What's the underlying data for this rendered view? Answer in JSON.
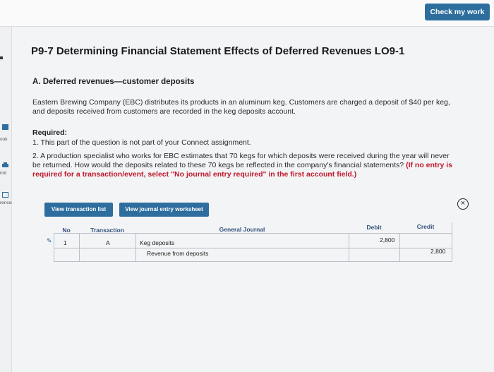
{
  "topbar": {
    "check_label": "Check my work"
  },
  "leftrail": {
    "item1": "ook",
    "item2": "rint",
    "item3": "rences"
  },
  "problem": {
    "title": "P9-7 Determining Financial Statement Effects of Deferred Revenues LO9-1",
    "section_title": "A. Deferred revenues—customer deposits",
    "intro_line1": "Eastern Brewing Company (EBC) distributes its products in an aluminum keg. Customers are charged a deposit of $40 per keg,",
    "intro_line2": "and deposits received from customers are recorded in the keg deposits account.",
    "required_label": "Required:",
    "req1": "1. This part of the question is not part of your Connect assignment.",
    "req2_line1": "2. A production specialist who works for EBC estimates that 70 kegs for which deposits were received during the year will never",
    "req2_line2_black": "be returned. How would the deposits related to these 70 kegs be reflected in the company's financial statements?",
    "req2_line2_red": " (If no entry is",
    "req2_line3_red": "required for a transaction/event, select \"No journal entry required\" in the first account field.)"
  },
  "tabs": {
    "view_transactions": "View transaction list",
    "view_worksheet": "View journal entry worksheet"
  },
  "journal": {
    "headers": {
      "no": "No",
      "transaction": "Transaction",
      "general_journal": "General Journal",
      "debit": "Debit",
      "credit": "Credit"
    },
    "row": {
      "no": "1",
      "transaction": "A",
      "account1": "Keg deposits",
      "debit1": "2,800",
      "account2": "Revenue from deposits",
      "credit2": "2,800"
    }
  }
}
